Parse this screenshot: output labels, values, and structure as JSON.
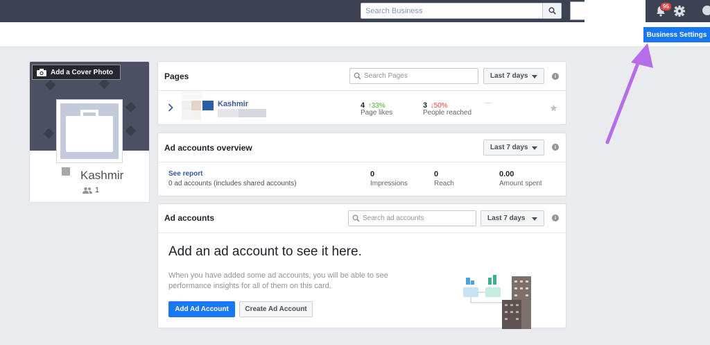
{
  "topbar": {
    "search_placeholder": "Search Business",
    "notification_count": "95",
    "icons": [
      "search-icon",
      "bell-icon",
      "gear-icon",
      "help-icon"
    ]
  },
  "header": {
    "business_settings_label": "Business Settings"
  },
  "profile": {
    "cover_button_label": "Add a Cover Photo",
    "name": "Kashmir",
    "people_count": "1"
  },
  "pages_card": {
    "title": "Pages",
    "search_placeholder": "Search Pages",
    "range_label": "Last 7 days",
    "row": {
      "name": "Kashmir",
      "likes_value": "4",
      "likes_change": "33%",
      "likes_label": "Page likes",
      "reach_value": "3",
      "reach_change": "50%",
      "reach_label": "People reached",
      "dash": "—"
    }
  },
  "overview_card": {
    "title": "Ad accounts overview",
    "range_label": "Last 7 days",
    "see_report": "See report",
    "accounts_text": "0 ad accounts (includes shared accounts)",
    "impressions_value": "0",
    "impressions_label": "Impressions",
    "reach_value": "0",
    "reach_label": "Reach",
    "spent_value": "0.00",
    "spent_label": "Amount spent"
  },
  "ad_accounts_card": {
    "title": "Ad accounts",
    "search_placeholder": "Search ad accounts",
    "range_label": "Last 7 days",
    "empty_heading": "Add an ad account to see it here.",
    "empty_text": "When you have added some ad accounts, you will be able to see performance insights for all of them on this card.",
    "add_button": "Add Ad Account",
    "create_button": "Create Ad Account"
  },
  "colors": {
    "topbar": "#3b4352",
    "accent": "#1877f2",
    "positive": "#42b72a",
    "negative": "#fa3e3e",
    "annotation_arrow": "#b66ee8"
  }
}
